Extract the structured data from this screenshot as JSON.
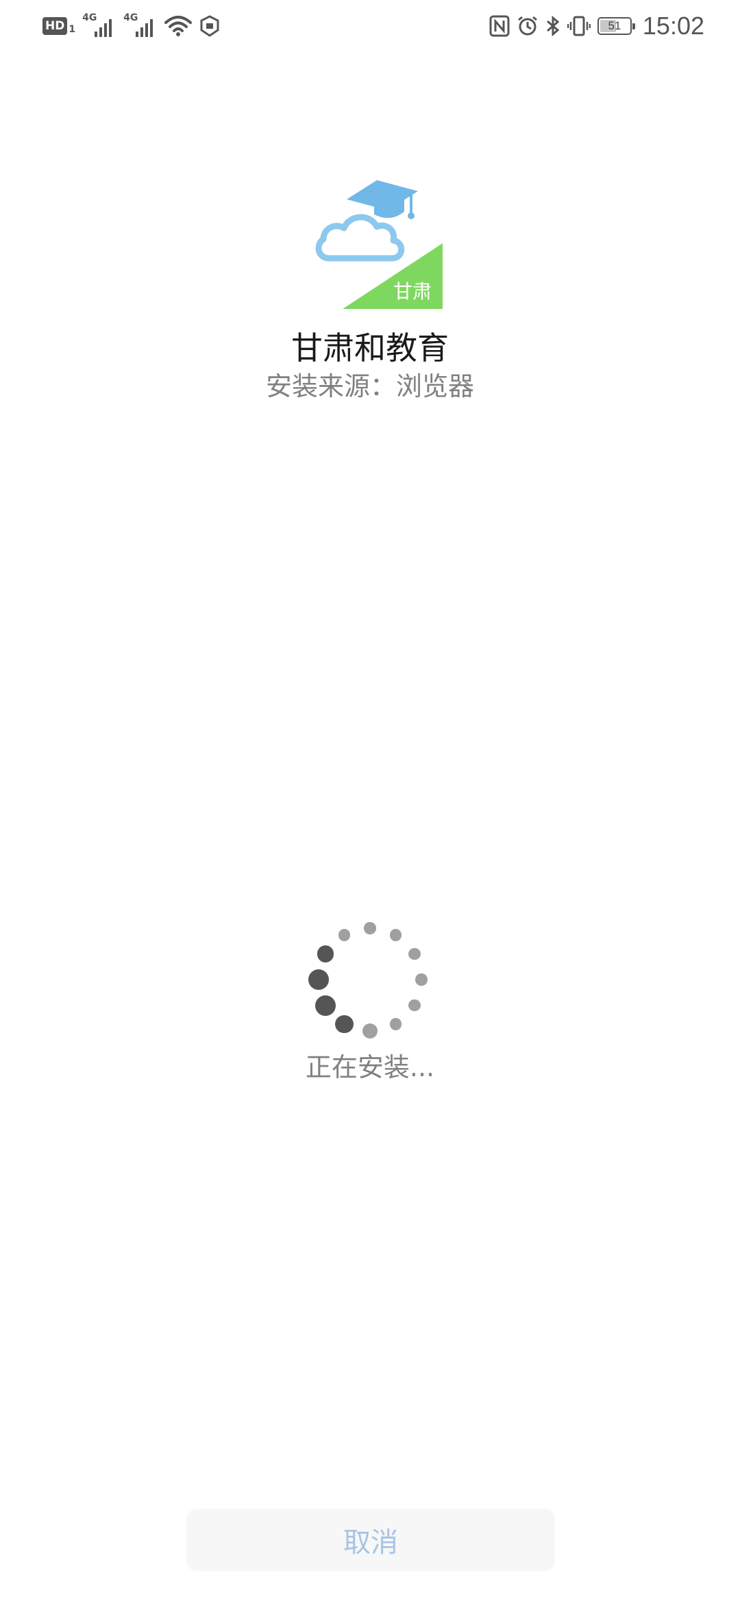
{
  "status_bar": {
    "hd_label": "HD",
    "hd_sub": "1",
    "sim1_tag": "4G",
    "sim2_tag": "4G",
    "battery_level": "51",
    "time": "15:02",
    "icons": [
      "hd-icon",
      "signal-icon",
      "signal-icon",
      "wifi-icon",
      "shield-icon",
      "nfc-icon",
      "alarm-icon",
      "bluetooth-icon",
      "vibrate-icon",
      "battery-icon"
    ]
  },
  "app": {
    "name": "甘肃和教育",
    "icon_badge": "甘肃",
    "install_source": "安装来源：浏览器"
  },
  "progress": {
    "status_text": "正在安装..."
  },
  "actions": {
    "cancel_label": "取消"
  },
  "colors": {
    "icon_cloud": "#8dc8ee",
    "icon_cap": "#6fb8e8",
    "icon_triangle": "#7ed85f",
    "cancel_text": "#a6c4e6",
    "spinner_dark": "#555555",
    "spinner_light": "#a0a0a0"
  }
}
